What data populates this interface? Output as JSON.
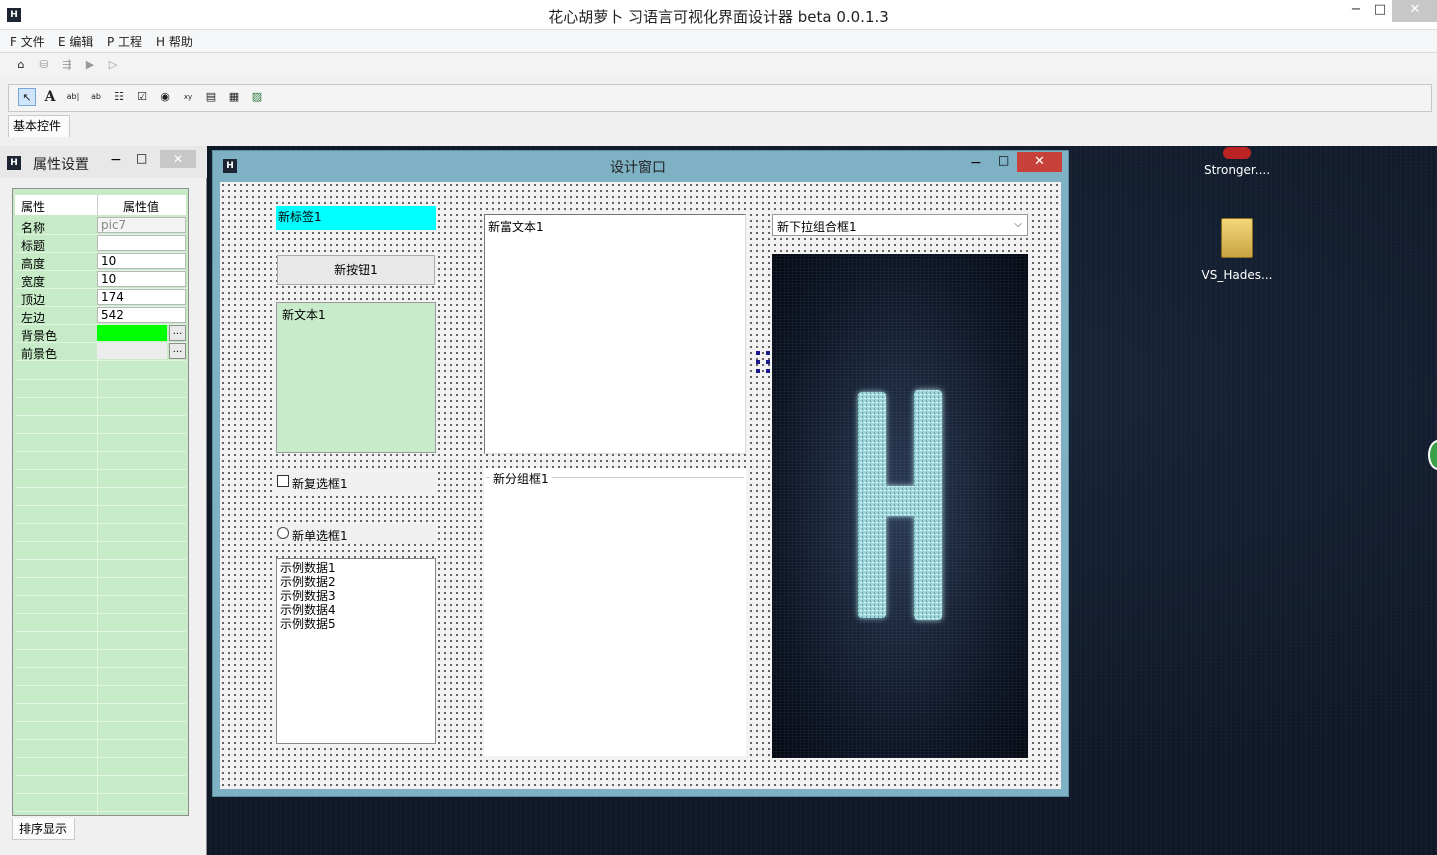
{
  "app": {
    "title": "花心胡萝卜 习语言可视化界面设计器 beta 0.0.1.3",
    "icon_letter": "H",
    "window_buttons": {
      "minimize": "−",
      "maximize": "□",
      "close": "✕"
    }
  },
  "menu": [
    "F 文件",
    "E 编辑",
    "P 工程",
    "H 帮助"
  ],
  "toolbar1": {
    "buttons": [
      "build-icon",
      "save-icon",
      "export-icon",
      "run-icon",
      "step-icon"
    ],
    "glyphs": [
      "⌂",
      "⛁",
      "⇶",
      "▶",
      "▷"
    ]
  },
  "toolbar2": {
    "tools": [
      {
        "name": "pointer-icon",
        "glyph": "↖",
        "selected": true
      },
      {
        "name": "label-tool-icon",
        "glyph": "A"
      },
      {
        "name": "textbox-tool-icon",
        "glyph": "ab|"
      },
      {
        "name": "button-tool-icon",
        "glyph": "ab"
      },
      {
        "name": "checkbox-list-tool-icon",
        "glyph": "☷"
      },
      {
        "name": "checkbox-tool-icon",
        "glyph": "☑"
      },
      {
        "name": "radio-tool-icon",
        "glyph": "◉"
      },
      {
        "name": "groupbox-tool-icon",
        "glyph": "xy"
      },
      {
        "name": "listbox-tool-icon",
        "glyph": "▤"
      },
      {
        "name": "combobox-tool-icon",
        "glyph": "▦"
      },
      {
        "name": "picture-tool-icon",
        "glyph": "▨"
      }
    ]
  },
  "tabs": {
    "basic_controls": "基本控件",
    "sort_display": "排序显示"
  },
  "properties": {
    "title": "属性设置",
    "header_key": "属性",
    "header_value": "属性值",
    "rows": [
      {
        "key": "名称",
        "value": "pic7",
        "readonly": true
      },
      {
        "key": "标题",
        "value": ""
      },
      {
        "key": "高度",
        "value": "10"
      },
      {
        "key": "宽度",
        "value": "10"
      },
      {
        "key": "顶边",
        "value": "174"
      },
      {
        "key": "左边",
        "value": "542"
      },
      {
        "key": "背景色",
        "value": "",
        "color": "#00ff00",
        "button": "..."
      },
      {
        "key": "前景色",
        "value": "",
        "color": "#ececec",
        "button": "..."
      }
    ]
  },
  "design_window": {
    "title": "设计窗口",
    "controls": {
      "label": "新标签1",
      "button": "新按钮1",
      "textbox": "新文本1",
      "checkbox": "新复选框1",
      "radio": "新单选框1",
      "listbox_items": [
        "示例数据1",
        "示例数据2",
        "示例数据3",
        "示例数据4",
        "示例数据5"
      ],
      "richtext": "新富文本1",
      "groupbox": "新分组框1",
      "combobox": "新下拉组合框1"
    },
    "label_bg": "#00ffff",
    "textbox_bg": "#c8ebc9"
  },
  "desktop": {
    "icons": [
      "Stronger....",
      "VS_Hades..."
    ]
  }
}
